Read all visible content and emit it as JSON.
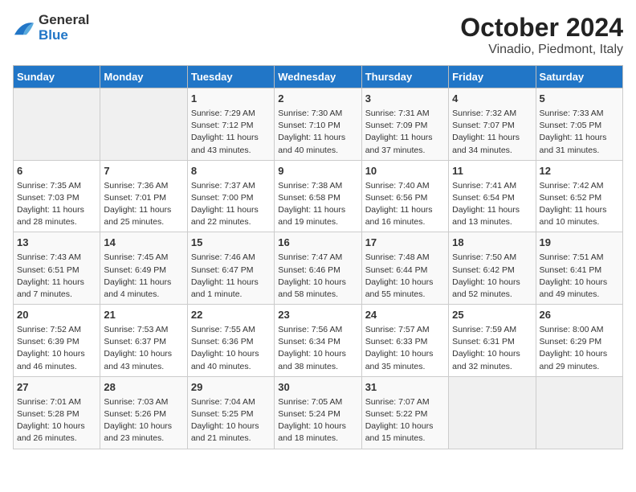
{
  "header": {
    "logo_line1": "General",
    "logo_line2": "Blue",
    "title": "October 2024",
    "subtitle": "Vinadio, Piedmont, Italy"
  },
  "days_of_week": [
    "Sunday",
    "Monday",
    "Tuesday",
    "Wednesday",
    "Thursday",
    "Friday",
    "Saturday"
  ],
  "weeks": [
    [
      {
        "day": "",
        "sunrise": "",
        "sunset": "",
        "daylight": ""
      },
      {
        "day": "",
        "sunrise": "",
        "sunset": "",
        "daylight": ""
      },
      {
        "day": "1",
        "sunrise": "Sunrise: 7:29 AM",
        "sunset": "Sunset: 7:12 PM",
        "daylight": "Daylight: 11 hours and 43 minutes."
      },
      {
        "day": "2",
        "sunrise": "Sunrise: 7:30 AM",
        "sunset": "Sunset: 7:10 PM",
        "daylight": "Daylight: 11 hours and 40 minutes."
      },
      {
        "day": "3",
        "sunrise": "Sunrise: 7:31 AM",
        "sunset": "Sunset: 7:09 PM",
        "daylight": "Daylight: 11 hours and 37 minutes."
      },
      {
        "day": "4",
        "sunrise": "Sunrise: 7:32 AM",
        "sunset": "Sunset: 7:07 PM",
        "daylight": "Daylight: 11 hours and 34 minutes."
      },
      {
        "day": "5",
        "sunrise": "Sunrise: 7:33 AM",
        "sunset": "Sunset: 7:05 PM",
        "daylight": "Daylight: 11 hours and 31 minutes."
      }
    ],
    [
      {
        "day": "6",
        "sunrise": "Sunrise: 7:35 AM",
        "sunset": "Sunset: 7:03 PM",
        "daylight": "Daylight: 11 hours and 28 minutes."
      },
      {
        "day": "7",
        "sunrise": "Sunrise: 7:36 AM",
        "sunset": "Sunset: 7:01 PM",
        "daylight": "Daylight: 11 hours and 25 minutes."
      },
      {
        "day": "8",
        "sunrise": "Sunrise: 7:37 AM",
        "sunset": "Sunset: 7:00 PM",
        "daylight": "Daylight: 11 hours and 22 minutes."
      },
      {
        "day": "9",
        "sunrise": "Sunrise: 7:38 AM",
        "sunset": "Sunset: 6:58 PM",
        "daylight": "Daylight: 11 hours and 19 minutes."
      },
      {
        "day": "10",
        "sunrise": "Sunrise: 7:40 AM",
        "sunset": "Sunset: 6:56 PM",
        "daylight": "Daylight: 11 hours and 16 minutes."
      },
      {
        "day": "11",
        "sunrise": "Sunrise: 7:41 AM",
        "sunset": "Sunset: 6:54 PM",
        "daylight": "Daylight: 11 hours and 13 minutes."
      },
      {
        "day": "12",
        "sunrise": "Sunrise: 7:42 AM",
        "sunset": "Sunset: 6:52 PM",
        "daylight": "Daylight: 11 hours and 10 minutes."
      }
    ],
    [
      {
        "day": "13",
        "sunrise": "Sunrise: 7:43 AM",
        "sunset": "Sunset: 6:51 PM",
        "daylight": "Daylight: 11 hours and 7 minutes."
      },
      {
        "day": "14",
        "sunrise": "Sunrise: 7:45 AM",
        "sunset": "Sunset: 6:49 PM",
        "daylight": "Daylight: 11 hours and 4 minutes."
      },
      {
        "day": "15",
        "sunrise": "Sunrise: 7:46 AM",
        "sunset": "Sunset: 6:47 PM",
        "daylight": "Daylight: 11 hours and 1 minute."
      },
      {
        "day": "16",
        "sunrise": "Sunrise: 7:47 AM",
        "sunset": "Sunset: 6:46 PM",
        "daylight": "Daylight: 10 hours and 58 minutes."
      },
      {
        "day": "17",
        "sunrise": "Sunrise: 7:48 AM",
        "sunset": "Sunset: 6:44 PM",
        "daylight": "Daylight: 10 hours and 55 minutes."
      },
      {
        "day": "18",
        "sunrise": "Sunrise: 7:50 AM",
        "sunset": "Sunset: 6:42 PM",
        "daylight": "Daylight: 10 hours and 52 minutes."
      },
      {
        "day": "19",
        "sunrise": "Sunrise: 7:51 AM",
        "sunset": "Sunset: 6:41 PM",
        "daylight": "Daylight: 10 hours and 49 minutes."
      }
    ],
    [
      {
        "day": "20",
        "sunrise": "Sunrise: 7:52 AM",
        "sunset": "Sunset: 6:39 PM",
        "daylight": "Daylight: 10 hours and 46 minutes."
      },
      {
        "day": "21",
        "sunrise": "Sunrise: 7:53 AM",
        "sunset": "Sunset: 6:37 PM",
        "daylight": "Daylight: 10 hours and 43 minutes."
      },
      {
        "day": "22",
        "sunrise": "Sunrise: 7:55 AM",
        "sunset": "Sunset: 6:36 PM",
        "daylight": "Daylight: 10 hours and 40 minutes."
      },
      {
        "day": "23",
        "sunrise": "Sunrise: 7:56 AM",
        "sunset": "Sunset: 6:34 PM",
        "daylight": "Daylight: 10 hours and 38 minutes."
      },
      {
        "day": "24",
        "sunrise": "Sunrise: 7:57 AM",
        "sunset": "Sunset: 6:33 PM",
        "daylight": "Daylight: 10 hours and 35 minutes."
      },
      {
        "day": "25",
        "sunrise": "Sunrise: 7:59 AM",
        "sunset": "Sunset: 6:31 PM",
        "daylight": "Daylight: 10 hours and 32 minutes."
      },
      {
        "day": "26",
        "sunrise": "Sunrise: 8:00 AM",
        "sunset": "Sunset: 6:29 PM",
        "daylight": "Daylight: 10 hours and 29 minutes."
      }
    ],
    [
      {
        "day": "27",
        "sunrise": "Sunrise: 7:01 AM",
        "sunset": "Sunset: 5:28 PM",
        "daylight": "Daylight: 10 hours and 26 minutes."
      },
      {
        "day": "28",
        "sunrise": "Sunrise: 7:03 AM",
        "sunset": "Sunset: 5:26 PM",
        "daylight": "Daylight: 10 hours and 23 minutes."
      },
      {
        "day": "29",
        "sunrise": "Sunrise: 7:04 AM",
        "sunset": "Sunset: 5:25 PM",
        "daylight": "Daylight: 10 hours and 21 minutes."
      },
      {
        "day": "30",
        "sunrise": "Sunrise: 7:05 AM",
        "sunset": "Sunset: 5:24 PM",
        "daylight": "Daylight: 10 hours and 18 minutes."
      },
      {
        "day": "31",
        "sunrise": "Sunrise: 7:07 AM",
        "sunset": "Sunset: 5:22 PM",
        "daylight": "Daylight: 10 hours and 15 minutes."
      },
      {
        "day": "",
        "sunrise": "",
        "sunset": "",
        "daylight": ""
      },
      {
        "day": "",
        "sunrise": "",
        "sunset": "",
        "daylight": ""
      }
    ]
  ]
}
